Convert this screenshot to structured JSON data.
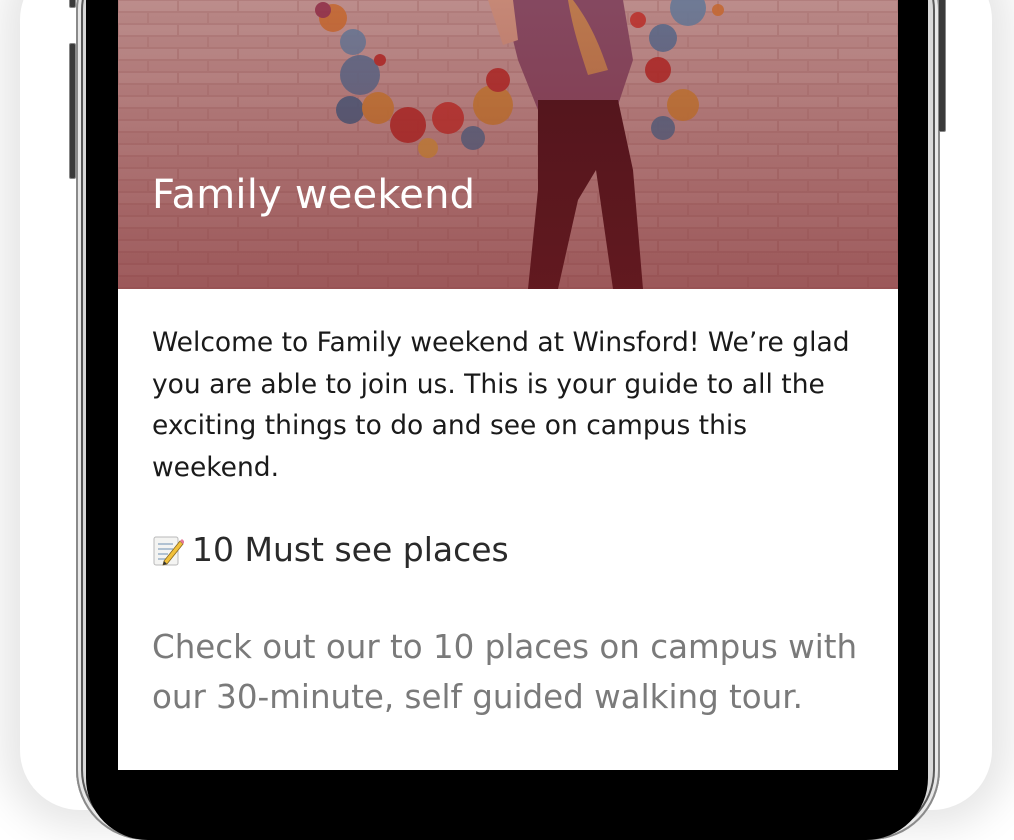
{
  "hero": {
    "title": "Family weekend",
    "image_icon": "person-at-mural-photo"
  },
  "intro": {
    "text": "Welcome to Family weekend at Winsford! We’re glad you are able to join us. This is your guide to all the exciting things to do and see on campus this weekend."
  },
  "section": {
    "icon": "memo-icon",
    "heading": "10 Must see places",
    "body": "Check out our to 10 places on campus with our 30-minute, self guided walking tour."
  },
  "colors": {
    "hero_overlay": "#7a1f24",
    "heading_text": "#2a2a2a",
    "body_text": "#1a1a1a",
    "muted_text": "#7a7a7a"
  }
}
